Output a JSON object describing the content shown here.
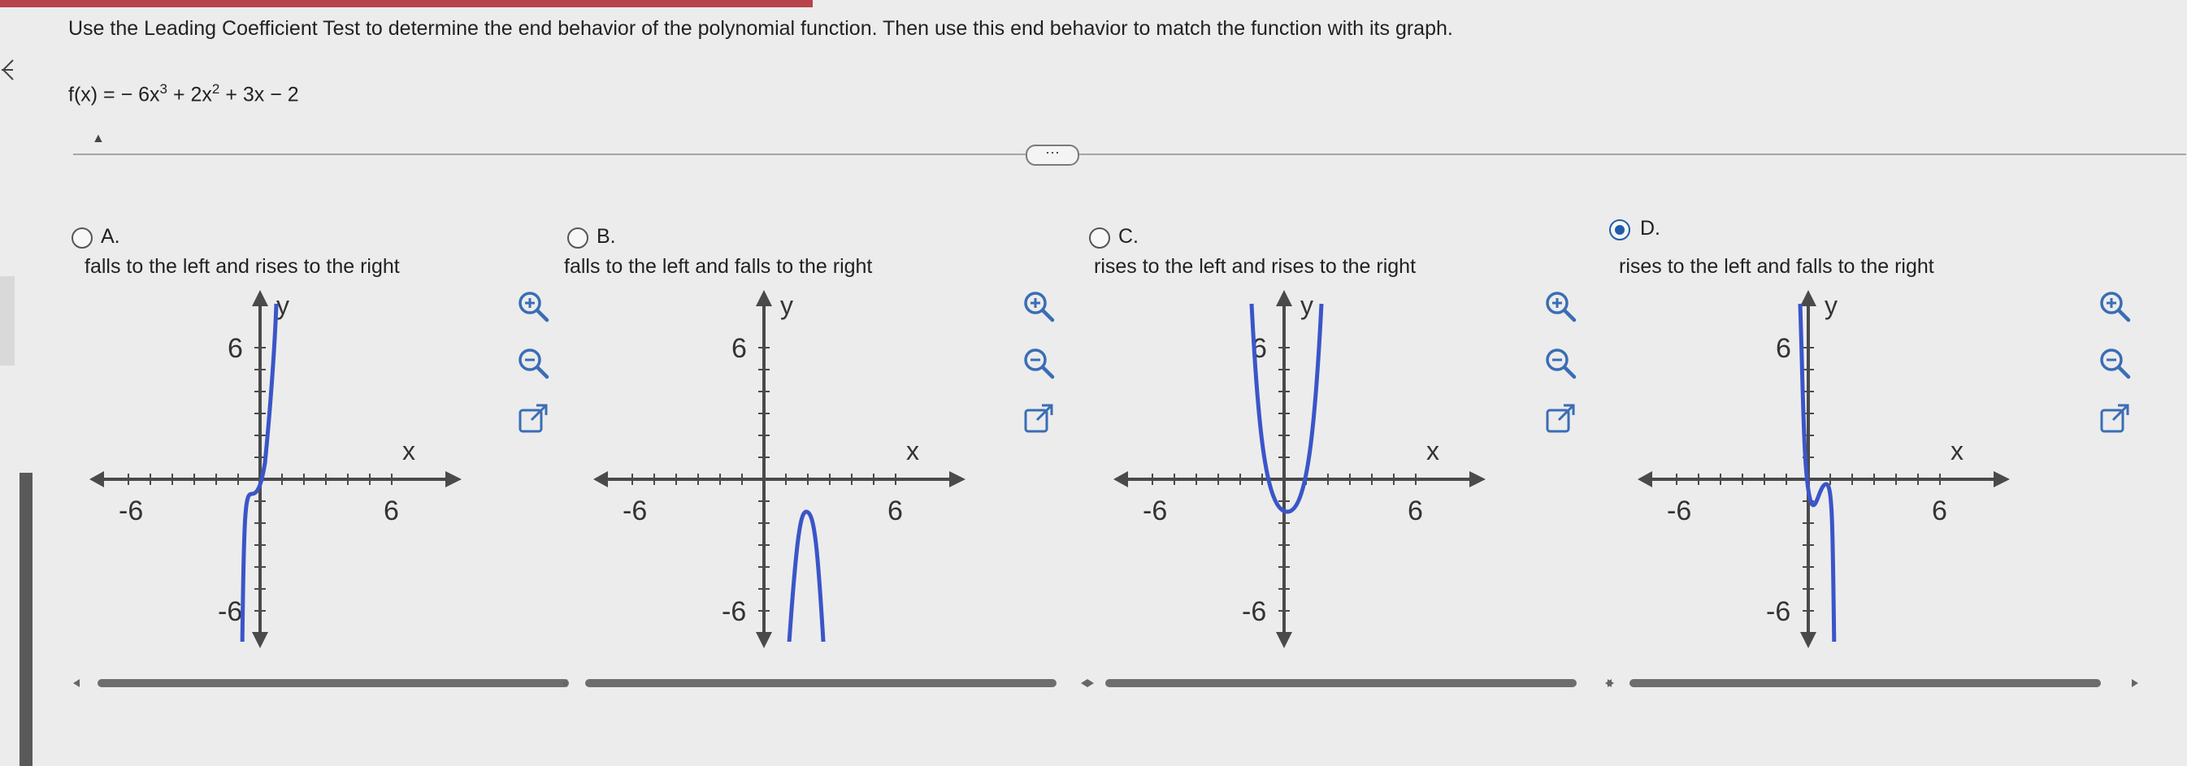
{
  "instruction": "Use the Leading Coefficient Test to determine the end behavior of the polynomial function. Then use this end behavior to match the function with its graph.",
  "function": {
    "prefix": "f(x) = − 6x",
    "exp1": "3",
    "mid": " + 2x",
    "exp2": "2",
    "suffix": " + 3x − 2"
  },
  "more_label": "···",
  "options": [
    {
      "letter": "A.",
      "description": "falls to the left and rises to the right",
      "selected": false
    },
    {
      "letter": "B.",
      "description": "falls to the left and falls to the right",
      "selected": false
    },
    {
      "letter": "C.",
      "description": "rises to the left and rises to the right",
      "selected": false
    },
    {
      "letter": "D.",
      "description": "rises to the left and falls to the right",
      "selected": true
    }
  ],
  "graph_labels": {
    "y": "y",
    "x": "x",
    "pos": "6",
    "neg": "-6"
  },
  "icons": [
    "zoom-in-icon",
    "zoom-out-icon",
    "open-external-icon"
  ],
  "colors": {
    "curve": "#3b55c8",
    "selected": "#1f5ea8",
    "axis": "#4a4a4a"
  }
}
